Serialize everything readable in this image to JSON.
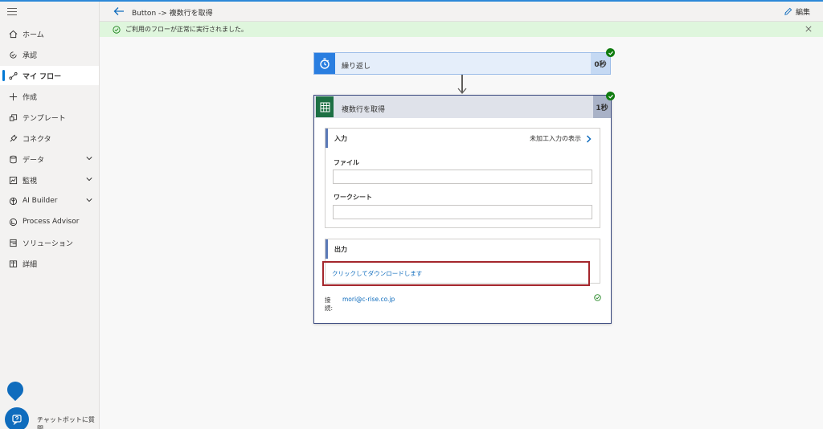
{
  "header": {
    "breadcrumb": "Button -> 複数行を取得",
    "edit_label": "編集"
  },
  "banner": {
    "message": "ご利用のフローが正常に実行されました。"
  },
  "sidebar": {
    "items": [
      {
        "label": "ホーム",
        "icon": "home-icon"
      },
      {
        "label": "承認",
        "icon": "approval-icon"
      },
      {
        "label": "マイ フロー",
        "icon": "flow-icon",
        "active": true
      },
      {
        "label": "作成",
        "icon": "plus-icon"
      },
      {
        "label": "テンプレート",
        "icon": "template-icon"
      },
      {
        "label": "コネクタ",
        "icon": "connector-icon"
      },
      {
        "label": "データ",
        "icon": "database-icon",
        "expandable": true
      },
      {
        "label": "監視",
        "icon": "monitor-icon",
        "expandable": true
      },
      {
        "label": "AI Builder",
        "icon": "ai-builder-icon",
        "expandable": true
      },
      {
        "label": "Process Advisor",
        "icon": "process-advisor-icon"
      },
      {
        "label": "ソリューション",
        "icon": "solution-icon"
      },
      {
        "label": "詳細",
        "icon": "book-icon"
      }
    ],
    "chatbot_label": "チャットボットに質問"
  },
  "flow": {
    "loop_step": {
      "title": "繰り返し",
      "duration": "0秒"
    },
    "get_rows_step": {
      "title": "複数行を取得",
      "duration": "1秒",
      "input_section": {
        "title": "入力",
        "raw_input_link": "未加工入力の表示",
        "fields": [
          {
            "label": "ファイル",
            "value": ""
          },
          {
            "label": "ワークシート",
            "value": ""
          }
        ]
      },
      "output_section": {
        "title": "出力",
        "download_link": "クリックしてダウンロードします"
      },
      "connection": {
        "label_line1": "接",
        "label_line2": "続:",
        "value": "mori@c-rise.co.jp"
      }
    }
  },
  "colors": {
    "accent": "#0078d4",
    "success": "#107c10",
    "banner_bg": "#dff6dd",
    "highlight_border": "#a4262c",
    "excel_green": "#1d7044"
  }
}
